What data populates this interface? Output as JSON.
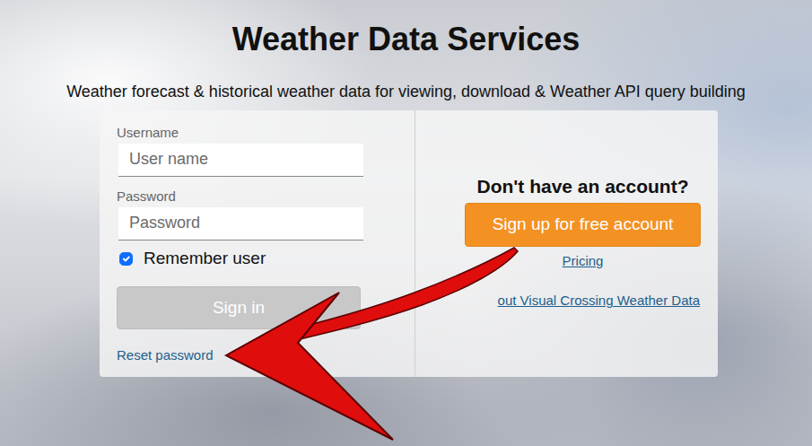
{
  "header": {
    "title": "Weather Data Services",
    "subtitle": "Weather forecast & historical weather data for viewing, download & Weather API query building"
  },
  "login": {
    "username_label": "Username",
    "username_placeholder": "User name",
    "password_label": "Password",
    "password_placeholder": "Password",
    "remember": {
      "label": "Remember user",
      "checked": true
    },
    "sign_in": {
      "label": "Sign in",
      "disabled": true
    },
    "reset": "Reset password"
  },
  "signup": {
    "prompt": "Don't have an account?",
    "button": "Sign up for free account",
    "links": [
      "Pricing",
      "out Visual Crossing Weather Data"
    ]
  }
}
